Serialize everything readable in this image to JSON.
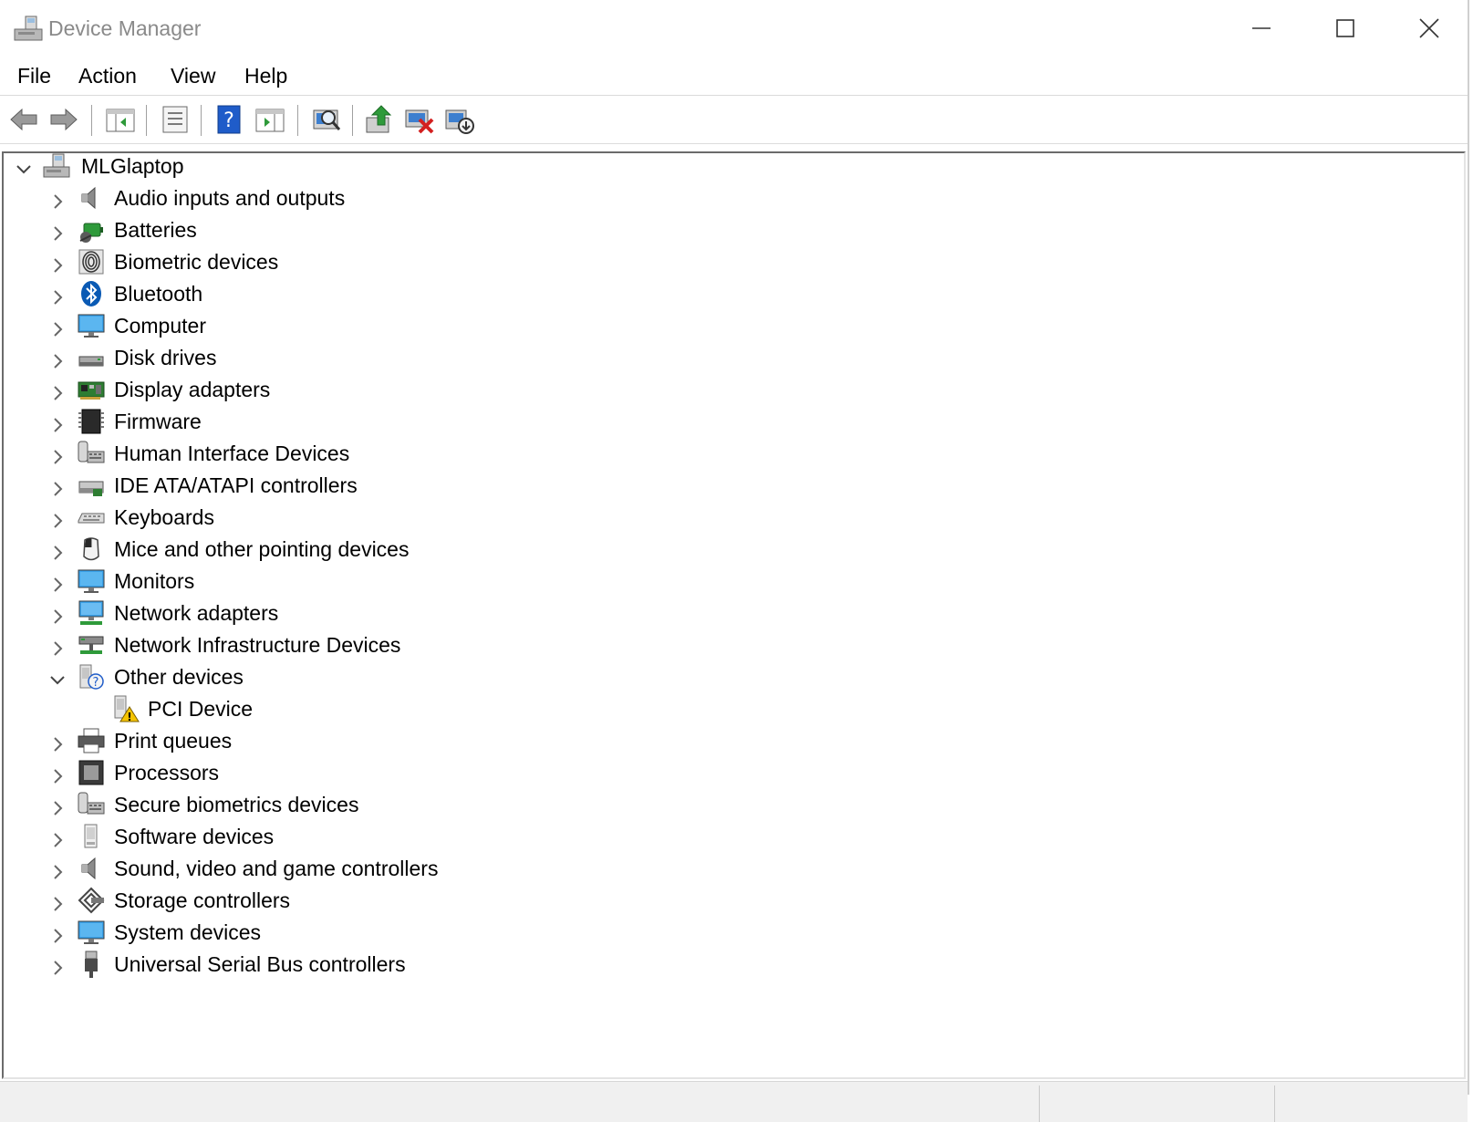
{
  "window": {
    "title": "Device Manager"
  },
  "menu": [
    "File",
    "Action",
    "View",
    "Help"
  ],
  "toolbar": [
    "back-icon",
    "forward-icon",
    "show-hide-console-tree-icon",
    "properties-icon",
    "help-icon",
    "action-pane-icon",
    "scan-hardware-icon",
    "update-driver-icon",
    "uninstall-device-icon",
    "disable-device-icon"
  ],
  "tree": {
    "root": "MLGlaptop",
    "items": [
      {
        "label": "Audio inputs and outputs",
        "icon": "speaker-icon"
      },
      {
        "label": "Batteries",
        "icon": "battery-icon"
      },
      {
        "label": "Biometric devices",
        "icon": "fingerprint-icon"
      },
      {
        "label": "Bluetooth",
        "icon": "bluetooth-icon"
      },
      {
        "label": "Computer",
        "icon": "monitor-icon"
      },
      {
        "label": "Disk drives",
        "icon": "disk-drive-icon"
      },
      {
        "label": "Display adapters",
        "icon": "display-adapter-icon"
      },
      {
        "label": "Firmware",
        "icon": "firmware-chip-icon"
      },
      {
        "label": "Human Interface Devices",
        "icon": "hid-icon"
      },
      {
        "label": "IDE ATA/ATAPI controllers",
        "icon": "ide-controller-icon"
      },
      {
        "label": "Keyboards",
        "icon": "keyboard-icon"
      },
      {
        "label": "Mice and other pointing devices",
        "icon": "mouse-icon"
      },
      {
        "label": "Monitors",
        "icon": "monitor-icon"
      },
      {
        "label": "Network adapters",
        "icon": "network-adapter-icon"
      },
      {
        "label": "Network Infrastructure Devices",
        "icon": "network-infrastructure-icon"
      },
      {
        "label": "Other devices",
        "icon": "unknown-device-icon",
        "expanded": true
      },
      {
        "label": "PCI Device",
        "icon": "warning-device-icon",
        "child": true
      },
      {
        "label": "Print queues",
        "icon": "printer-icon"
      },
      {
        "label": "Processors",
        "icon": "processor-icon"
      },
      {
        "label": "Secure biometrics devices",
        "icon": "hid-icon"
      },
      {
        "label": "Software devices",
        "icon": "software-device-icon"
      },
      {
        "label": "Sound, video and game controllers",
        "icon": "speaker-icon"
      },
      {
        "label": "Storage controllers",
        "icon": "storage-controller-icon"
      },
      {
        "label": "System devices",
        "icon": "monitor-icon"
      },
      {
        "label": "Universal Serial Bus controllers",
        "icon": "usb-icon"
      }
    ]
  },
  "colors": {
    "title_text": "#8a8a8a",
    "accent_blue": "#2e7fd6"
  }
}
